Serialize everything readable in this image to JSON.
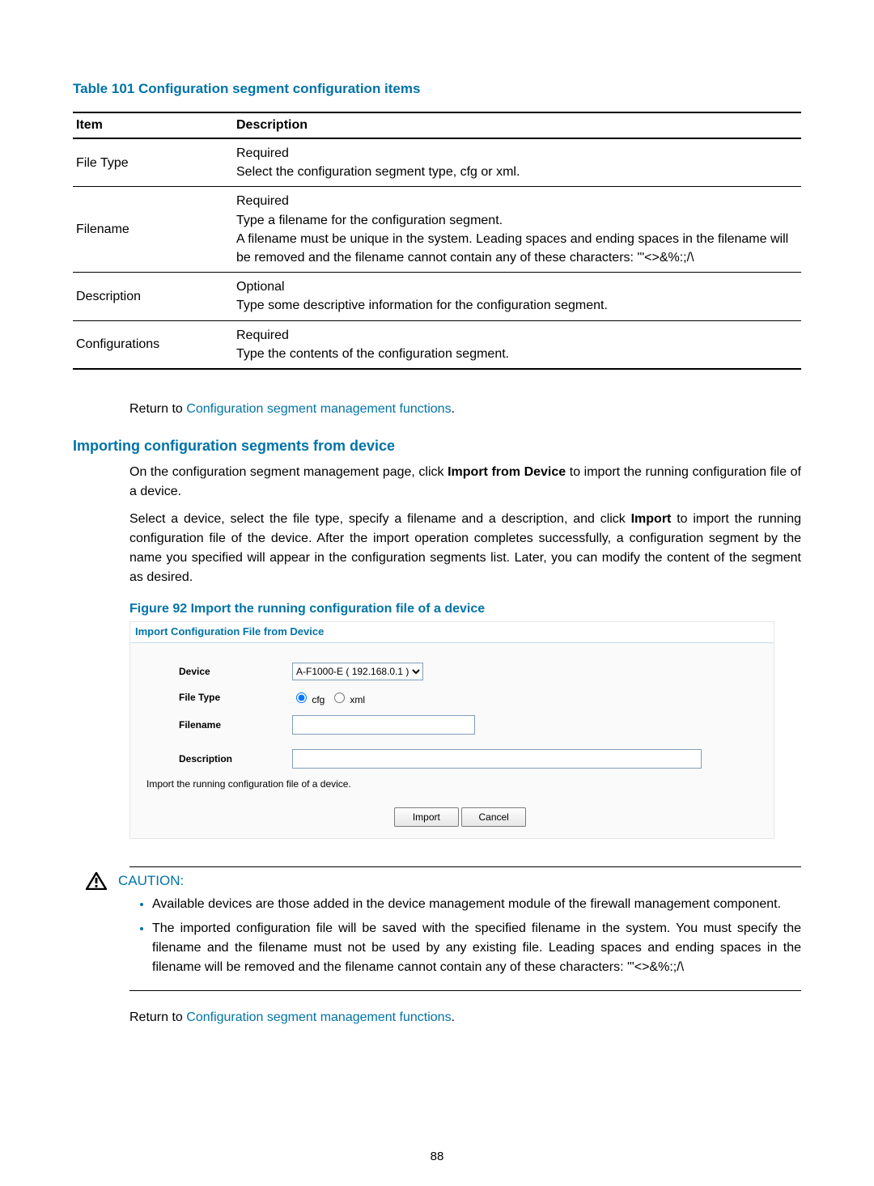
{
  "table": {
    "caption": "Table 101 Configuration segment configuration items",
    "headers": {
      "item": "Item",
      "description": "Description"
    },
    "rows": [
      {
        "item": "File Type",
        "desc": "Required\nSelect the configuration segment type, cfg or xml."
      },
      {
        "item": "Filename",
        "desc": "Required\nType a filename for the configuration segment.\nA filename must be unique in the system. Leading spaces and ending spaces in the filename will be removed and the filename cannot contain any of these characters: '\"<>&%:;/\\"
      },
      {
        "item": "Description",
        "desc": "Optional\nType some descriptive information for the configuration segment."
      },
      {
        "item": "Configurations",
        "desc": "Required\nType the contents of the configuration segment."
      }
    ]
  },
  "return_prefix": "Return to ",
  "return_link": "Configuration segment management functions",
  "return_suffix": ".",
  "section_heading": "Importing configuration segments from device",
  "para1_a": "On the configuration segment management page, click ",
  "para1_b": "Import from Device",
  "para1_c": " to import the running configuration file of a device.",
  "para2_a": "Select a device, select the file type, specify a filename and a description, and click ",
  "para2_b": "Import",
  "para2_c": " to import the running configuration file of the device. After the import operation completes successfully, a configuration segment by the name you specified will appear in the configuration segments list. Later, you can modify the content of the segment as desired.",
  "figure_caption": "Figure 92 Import the running configuration file of a device",
  "screenshot": {
    "title": "Import Configuration File from Device",
    "labels": {
      "device": "Device",
      "file_type": "File Type",
      "filename": "Filename",
      "description": "Description"
    },
    "device_selected": "A-F1000-E ( 192.168.0.1 )",
    "radio_cfg": "cfg",
    "radio_xml": "xml",
    "hint": "Import the running configuration file of a device.",
    "buttons": {
      "import": "Import",
      "cancel": "Cancel"
    }
  },
  "caution": {
    "label": "CAUTION:",
    "items": [
      "Available devices are those added in the device management module of the firewall management component.",
      "The imported configuration file will be saved with the specified filename in the system. You must specify the filename and the filename must not be used by any existing file. Leading spaces and ending spaces in the filename will be removed and the filename cannot contain any of these characters: '\"<>&%:;/\\"
    ]
  },
  "page_number": "88"
}
